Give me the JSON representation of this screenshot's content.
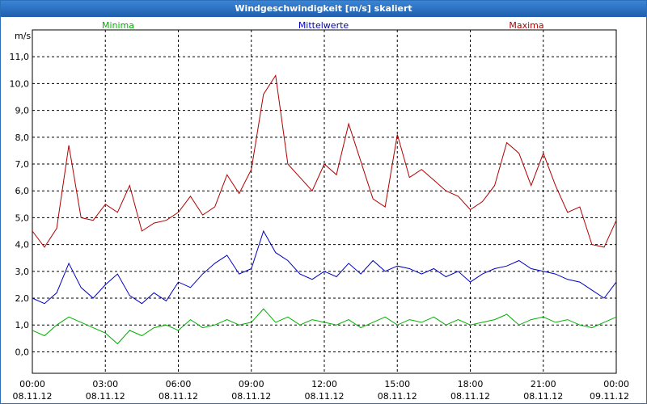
{
  "window": {
    "title": "Windgeschwindigkeit [m/s] skaliert"
  },
  "chart_data": {
    "type": "line",
    "ylabel": "m/s",
    "ylim": [
      -0.8,
      12.0
    ],
    "grid": true,
    "y_ticks": [
      "0,0",
      "1,0",
      "2,0",
      "3,0",
      "4,0",
      "5,0",
      "6,0",
      "7,0",
      "8,0",
      "9,0",
      "10,0",
      "11,0"
    ],
    "x_ticks": [
      {
        "time": "00:00",
        "date": "08.11.12"
      },
      {
        "time": "03:00",
        "date": "08.11.12"
      },
      {
        "time": "06:00",
        "date": "08.11.12"
      },
      {
        "time": "09:00",
        "date": "08.11.12"
      },
      {
        "time": "12:00",
        "date": "08.11.12"
      },
      {
        "time": "15:00",
        "date": "08.11.12"
      },
      {
        "time": "18:00",
        "date": "08.11.12"
      },
      {
        "time": "21:00",
        "date": "08.11.12"
      },
      {
        "time": "00:00",
        "date": "09.11.12"
      }
    ],
    "x_unit": "hours",
    "x_range": [
      0,
      24
    ],
    "x": [
      0.0,
      0.5,
      1.0,
      1.5,
      2.0,
      2.5,
      3.0,
      3.5,
      4.0,
      4.5,
      5.0,
      5.5,
      6.0,
      6.5,
      7.0,
      7.5,
      8.0,
      8.5,
      9.0,
      9.5,
      10.0,
      10.5,
      11.0,
      11.5,
      12.0,
      12.5,
      13.0,
      13.5,
      14.0,
      14.5,
      15.0,
      15.5,
      16.0,
      16.5,
      17.0,
      17.5,
      18.0,
      18.5,
      19.0,
      19.5,
      20.0,
      20.5,
      21.0,
      21.5,
      22.0,
      22.5,
      23.0,
      23.5,
      24.0
    ],
    "series": [
      {
        "name": "Minima",
        "color": "#00b000",
        "values": [
          0.8,
          0.6,
          1.0,
          1.3,
          1.1,
          0.9,
          0.7,
          0.3,
          0.8,
          0.6,
          0.9,
          1.0,
          0.8,
          1.2,
          0.9,
          1.0,
          1.2,
          1.0,
          1.1,
          1.6,
          1.1,
          1.3,
          1.0,
          1.2,
          1.1,
          1.0,
          1.2,
          0.9,
          1.1,
          1.3,
          1.0,
          1.2,
          1.1,
          1.3,
          1.0,
          1.2,
          1.0,
          1.1,
          1.2,
          1.4,
          1.0,
          1.2,
          1.3,
          1.1,
          1.2,
          1.0,
          0.9,
          1.1,
          1.3
        ]
      },
      {
        "name": "Mittelwerte",
        "color": "#0000c0",
        "values": [
          2.0,
          1.8,
          2.2,
          3.3,
          2.4,
          2.0,
          2.5,
          2.9,
          2.1,
          1.8,
          2.2,
          1.9,
          2.6,
          2.4,
          2.9,
          3.3,
          3.6,
          2.9,
          3.1,
          4.5,
          3.7,
          3.4,
          2.9,
          2.7,
          3.0,
          2.8,
          3.3,
          2.9,
          3.4,
          3.0,
          3.2,
          3.1,
          2.9,
          3.1,
          2.8,
          3.0,
          2.6,
          2.9,
          3.1,
          3.2,
          3.4,
          3.1,
          3.0,
          2.9,
          2.7,
          2.6,
          2.3,
          2.0,
          2.6
        ]
      },
      {
        "name": "Maxima",
        "color": "#b00000",
        "values": [
          4.5,
          3.9,
          4.6,
          7.7,
          5.0,
          4.9,
          5.5,
          5.2,
          6.2,
          4.5,
          4.8,
          4.9,
          5.2,
          5.8,
          5.1,
          5.4,
          6.6,
          5.9,
          6.8,
          9.6,
          10.3,
          7.0,
          6.5,
          6.0,
          7.0,
          6.6,
          8.5,
          7.1,
          5.7,
          5.4,
          8.1,
          6.5,
          6.8,
          6.4,
          6.0,
          5.8,
          5.3,
          5.6,
          6.2,
          7.8,
          7.4,
          6.2,
          7.4,
          6.2,
          5.2,
          5.4,
          4.0,
          3.9,
          4.9
        ]
      }
    ]
  }
}
